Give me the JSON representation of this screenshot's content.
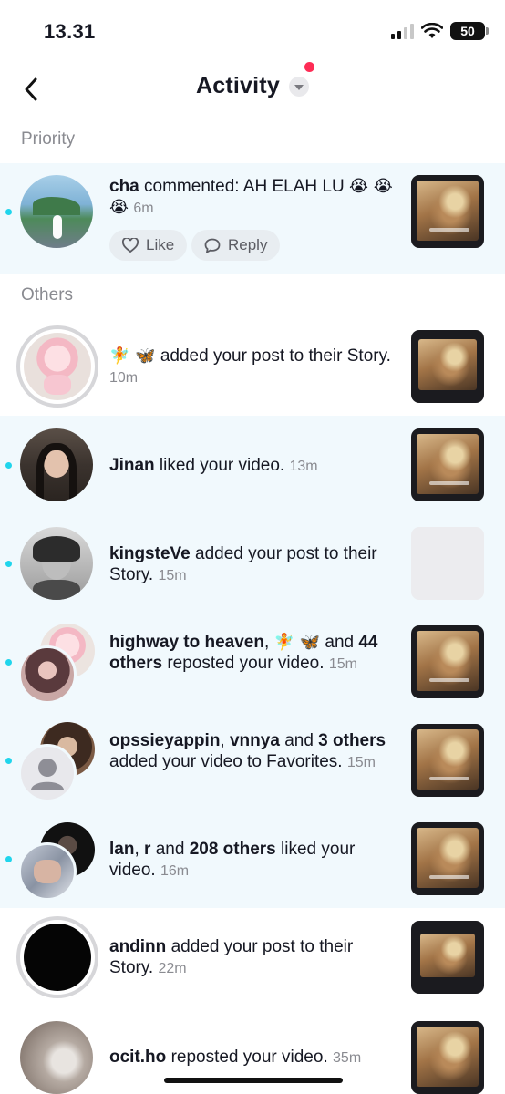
{
  "status_bar": {
    "time": "13.31",
    "battery": "50"
  },
  "header": {
    "title": "Activity",
    "back_icon": "chevron-left-icon",
    "dropdown_icon": "caret-down-icon",
    "notification_dot_color": "#fe2c55"
  },
  "sections": {
    "priority": "Priority",
    "others": "Others"
  },
  "priority_item": {
    "username": "cha",
    "action": "commented: AH ELAH LU",
    "emoji": "😭 😭 😭",
    "time": "6m",
    "like_label": "Like",
    "reply_label": "Reply"
  },
  "items": [
    {
      "emoji": "🧚 🦋",
      "action": "added your post to their Story.",
      "time": "10m"
    },
    {
      "username": "Jinan",
      "action": "liked your video.",
      "time": "13m"
    },
    {
      "username": "kingsteVe",
      "action": "added your post to their Story.",
      "time": "15m"
    },
    {
      "username": "highway to heaven",
      "sep": ",",
      "emoji": "🧚 🦋",
      "and": "and",
      "others": "44 others",
      "action": "reposted your video.",
      "time": "15m"
    },
    {
      "username": "opssieyappin",
      "sep": ",",
      "user2": "vnnya",
      "and": "and",
      "others": "3 others",
      "action": "added your video to Favorites.",
      "time": "15m"
    },
    {
      "username": "lan",
      "sep": ",",
      "user2": "r",
      "and": "and",
      "others": "208 others",
      "action": "liked your video.",
      "time": "16m"
    },
    {
      "username": "andinn",
      "action": "added your post to their Story.",
      "time": "22m"
    },
    {
      "username": "ocit.ho",
      "action": "reposted your video.",
      "time": "35m"
    }
  ],
  "colors": {
    "unread_background": "#f1f9fd",
    "unread_dot": "#20d5ec",
    "secondary_text": "#8a8b91"
  }
}
